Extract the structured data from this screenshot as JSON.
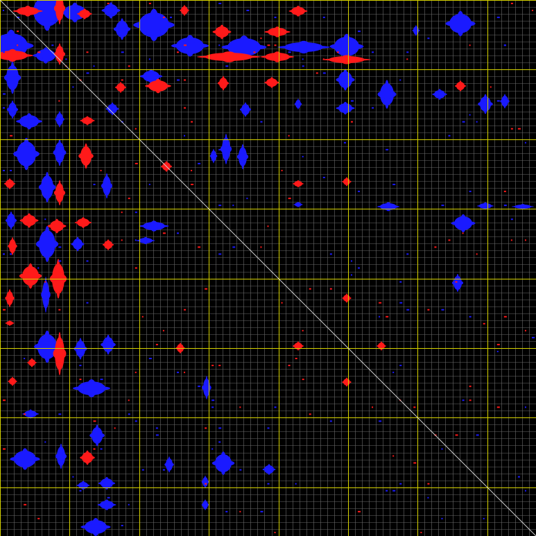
{
  "image": {
    "kind": "contact map / dot plot",
    "background": "#000000",
    "colors": {
      "minor_grid": "#6b6b6b",
      "major_grid": "#d8d400",
      "diagonal": "#cfcfcf",
      "blue_blob": "#1a1aff",
      "red_blob": "#ff1a1a"
    },
    "grid": {
      "minor_divisions": 77,
      "major_every": 10,
      "diagonal": true
    }
  },
  "blue_regions": [
    [
      68,
      16,
      20,
      22
    ],
    [
      108,
      18,
      16,
      11
    ],
    [
      160,
      15,
      10,
      9
    ],
    [
      222,
      36,
      22,
      18
    ],
    [
      176,
      42,
      9,
      12
    ],
    [
      16,
      66,
      24,
      18
    ],
    [
      274,
      66,
      20,
      12
    ],
    [
      352,
      68,
      24,
      13
    ],
    [
      438,
      68,
      28,
      7
    ],
    [
      500,
      67,
      18,
      14
    ],
    [
      664,
      34,
      16,
      14
    ],
    [
      66,
      80,
      14,
      9
    ],
    [
      18,
      112,
      9,
      18
    ],
    [
      218,
      110,
      12,
      8
    ],
    [
      498,
      115,
      10,
      12
    ],
    [
      558,
      136,
      10,
      16
    ],
    [
      634,
      136,
      8,
      6
    ],
    [
      700,
      150,
      8,
      11
    ],
    [
      728,
      146,
      5,
      8
    ],
    [
      18,
      158,
      6,
      10
    ],
    [
      42,
      175,
      14,
      9
    ],
    [
      86,
      172,
      5,
      9
    ],
    [
      162,
      157,
      7,
      7
    ],
    [
      354,
      158,
      6,
      8
    ],
    [
      430,
      150,
      4,
      6
    ],
    [
      498,
      156,
      10,
      7
    ],
    [
      38,
      222,
      14,
      18
    ],
    [
      86,
      220,
      7,
      15
    ],
    [
      326,
      215,
      6,
      17
    ],
    [
      350,
      226,
      6,
      14
    ],
    [
      308,
      225,
      4,
      8
    ],
    [
      68,
      270,
      9,
      17
    ],
    [
      154,
      268,
      6,
      14
    ],
    [
      560,
      298,
      12,
      5
    ],
    [
      700,
      297,
      9,
      4
    ],
    [
      754,
      298,
      12,
      3
    ],
    [
      668,
      322,
      13,
      10
    ],
    [
      222,
      326,
      16,
      6
    ],
    [
      210,
      347,
      10,
      4
    ],
    [
      68,
      352,
      12,
      20
    ],
    [
      16,
      318,
      6,
      10
    ],
    [
      112,
      352,
      7,
      8
    ],
    [
      66,
      425,
      5,
      20
    ],
    [
      68,
      500,
      14,
      18
    ],
    [
      156,
      497,
      8,
      11
    ],
    [
      116,
      503,
      7,
      12
    ],
    [
      132,
      560,
      20,
      10
    ],
    [
      298,
      559,
      5,
      13
    ],
    [
      44,
      597,
      9,
      5
    ],
    [
      140,
      628,
      8,
      12
    ],
    [
      36,
      662,
      16,
      12
    ],
    [
      88,
      658,
      6,
      14
    ],
    [
      322,
      668,
      12,
      13
    ],
    [
      244,
      670,
      5,
      9
    ],
    [
      388,
      677,
      7,
      6
    ],
    [
      154,
      697,
      9,
      7
    ],
    [
      120,
      700,
      7,
      5
    ],
    [
      296,
      695,
      4,
      7
    ],
    [
      154,
      728,
      10,
      6
    ],
    [
      138,
      760,
      16,
      10
    ],
    [
      296,
      728,
      4,
      6
    ],
    [
      660,
      408,
      6,
      10
    ],
    [
      600,
      44,
      4,
      6
    ],
    [
      430,
      295,
      5,
      3
    ]
  ],
  "red_regions": [
    [
      40,
      16,
      16,
      6
    ],
    [
      86,
      12,
      6,
      18
    ],
    [
      122,
      20,
      8,
      6
    ],
    [
      266,
      15,
      5,
      6
    ],
    [
      430,
      16,
      10,
      6
    ],
    [
      320,
      46,
      10,
      8
    ],
    [
      400,
      46,
      14,
      6
    ],
    [
      18,
      80,
      22,
      7
    ],
    [
      86,
      78,
      6,
      12
    ],
    [
      330,
      82,
      34,
      6
    ],
    [
      400,
      82,
      18,
      6
    ],
    [
      500,
      86,
      26,
      5
    ],
    [
      228,
      124,
      14,
      8
    ],
    [
      174,
      126,
      6,
      6
    ],
    [
      322,
      120,
      6,
      8
    ],
    [
      392,
      119,
      8,
      6
    ],
    [
      126,
      174,
      8,
      5
    ],
    [
      124,
      225,
      8,
      14
    ],
    [
      240,
      240,
      6,
      6
    ],
    [
      14,
      265,
      6,
      6
    ],
    [
      86,
      278,
      6,
      14
    ],
    [
      42,
      318,
      10,
      8
    ],
    [
      82,
      326,
      10,
      8
    ],
    [
      120,
      321,
      9,
      6
    ],
    [
      156,
      353,
      6,
      6
    ],
    [
      18,
      355,
      5,
      10
    ],
    [
      44,
      398,
      12,
      14
    ],
    [
      84,
      402,
      9,
      22
    ],
    [
      14,
      430,
      5,
      10
    ],
    [
      14,
      466,
      5,
      3
    ],
    [
      86,
      510,
      7,
      24
    ],
    [
      46,
      523,
      5,
      5
    ],
    [
      430,
      499,
      6,
      5
    ],
    [
      500,
      430,
      5,
      5
    ],
    [
      500,
      551,
      5,
      5
    ],
    [
      550,
      499,
      5,
      5
    ],
    [
      260,
      502,
      5,
      6
    ],
    [
      126,
      660,
      8,
      8
    ],
    [
      18,
      550,
      5,
      5
    ],
    [
      664,
      124,
      6,
      6
    ],
    [
      500,
      262,
      5,
      5
    ],
    [
      430,
      265,
      6,
      4
    ]
  ]
}
